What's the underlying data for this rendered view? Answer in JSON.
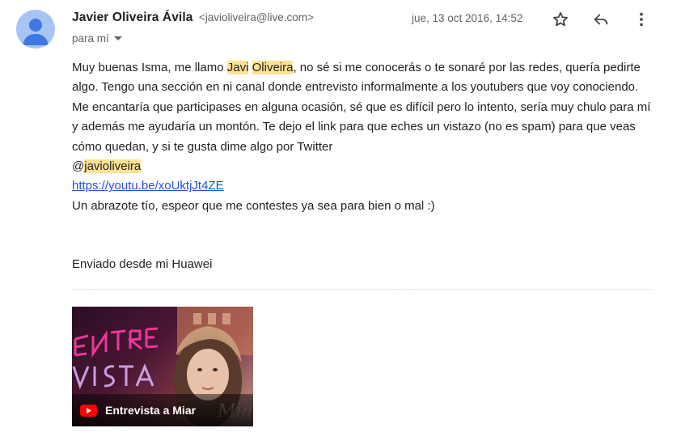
{
  "sender": {
    "name": "Javier Oliveira Ávila",
    "email": "<javioliveira@live.com>",
    "avatar_icon": "person-avatar-icon"
  },
  "recipient": {
    "label": "para mí"
  },
  "date": "jue, 13 oct 2016, 14:52",
  "actions": {
    "star_icon": "star-icon",
    "reply_icon": "reply-icon",
    "more_icon": "more-vert-icon"
  },
  "body": {
    "line1_pre": "Muy buenas Isma, me llamo ",
    "hl_first": "Javi",
    "hl_last": "Oliveira",
    "line1_post": ", no sé si me conocerás o te sonaré por las redes, quería pedirte algo. Tengo una sección en ni canal donde entrevisto informalmente a los youtubers que voy conociendo. Me encantaría que participases en alguna ocasión, sé que es difícil pero lo intento, sería muy chulo para mí y además me ayudaría un montón. Te dejo el link para que eches un vistazo (no es spam) para que veas cómo quedan, y si te gusta dime algo por Twitter",
    "at_sign": "@",
    "handle": "javioliveira",
    "link": "https://youtu.be/xoUktjJt4ZE",
    "closing": "Un abrazote tío, espeor que me contestes ya sea para bien o mal :)"
  },
  "signature": "Enviado desde mi Huawei",
  "attachment": {
    "title": "Entrevista a Miar",
    "icon": "youtube-icon",
    "highlight_color": "#fde293",
    "link_color": "#1a55d4"
  }
}
